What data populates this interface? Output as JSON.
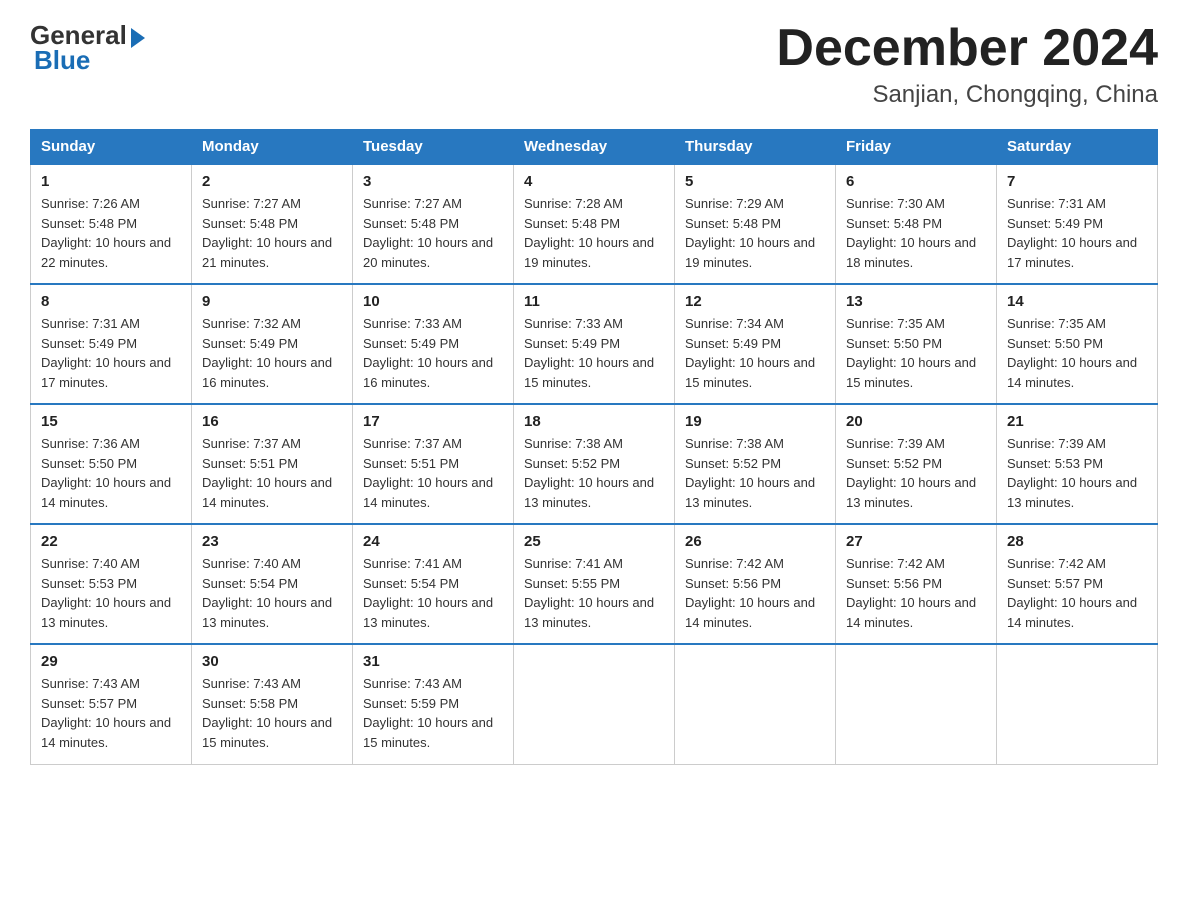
{
  "logo": {
    "general": "General",
    "blue": "Blue"
  },
  "header": {
    "month": "December 2024",
    "location": "Sanjian, Chongqing, China"
  },
  "days_of_week": [
    "Sunday",
    "Monday",
    "Tuesday",
    "Wednesday",
    "Thursday",
    "Friday",
    "Saturday"
  ],
  "weeks": [
    [
      {
        "day": "1",
        "sunrise": "7:26 AM",
        "sunset": "5:48 PM",
        "daylight": "10 hours and 22 minutes."
      },
      {
        "day": "2",
        "sunrise": "7:27 AM",
        "sunset": "5:48 PM",
        "daylight": "10 hours and 21 minutes."
      },
      {
        "day": "3",
        "sunrise": "7:27 AM",
        "sunset": "5:48 PM",
        "daylight": "10 hours and 20 minutes."
      },
      {
        "day": "4",
        "sunrise": "7:28 AM",
        "sunset": "5:48 PM",
        "daylight": "10 hours and 19 minutes."
      },
      {
        "day": "5",
        "sunrise": "7:29 AM",
        "sunset": "5:48 PM",
        "daylight": "10 hours and 19 minutes."
      },
      {
        "day": "6",
        "sunrise": "7:30 AM",
        "sunset": "5:48 PM",
        "daylight": "10 hours and 18 minutes."
      },
      {
        "day": "7",
        "sunrise": "7:31 AM",
        "sunset": "5:49 PM",
        "daylight": "10 hours and 17 minutes."
      }
    ],
    [
      {
        "day": "8",
        "sunrise": "7:31 AM",
        "sunset": "5:49 PM",
        "daylight": "10 hours and 17 minutes."
      },
      {
        "day": "9",
        "sunrise": "7:32 AM",
        "sunset": "5:49 PM",
        "daylight": "10 hours and 16 minutes."
      },
      {
        "day": "10",
        "sunrise": "7:33 AM",
        "sunset": "5:49 PM",
        "daylight": "10 hours and 16 minutes."
      },
      {
        "day": "11",
        "sunrise": "7:33 AM",
        "sunset": "5:49 PM",
        "daylight": "10 hours and 15 minutes."
      },
      {
        "day": "12",
        "sunrise": "7:34 AM",
        "sunset": "5:49 PM",
        "daylight": "10 hours and 15 minutes."
      },
      {
        "day": "13",
        "sunrise": "7:35 AM",
        "sunset": "5:50 PM",
        "daylight": "10 hours and 15 minutes."
      },
      {
        "day": "14",
        "sunrise": "7:35 AM",
        "sunset": "5:50 PM",
        "daylight": "10 hours and 14 minutes."
      }
    ],
    [
      {
        "day": "15",
        "sunrise": "7:36 AM",
        "sunset": "5:50 PM",
        "daylight": "10 hours and 14 minutes."
      },
      {
        "day": "16",
        "sunrise": "7:37 AM",
        "sunset": "5:51 PM",
        "daylight": "10 hours and 14 minutes."
      },
      {
        "day": "17",
        "sunrise": "7:37 AM",
        "sunset": "5:51 PM",
        "daylight": "10 hours and 14 minutes."
      },
      {
        "day": "18",
        "sunrise": "7:38 AM",
        "sunset": "5:52 PM",
        "daylight": "10 hours and 13 minutes."
      },
      {
        "day": "19",
        "sunrise": "7:38 AM",
        "sunset": "5:52 PM",
        "daylight": "10 hours and 13 minutes."
      },
      {
        "day": "20",
        "sunrise": "7:39 AM",
        "sunset": "5:52 PM",
        "daylight": "10 hours and 13 minutes."
      },
      {
        "day": "21",
        "sunrise": "7:39 AM",
        "sunset": "5:53 PM",
        "daylight": "10 hours and 13 minutes."
      }
    ],
    [
      {
        "day": "22",
        "sunrise": "7:40 AM",
        "sunset": "5:53 PM",
        "daylight": "10 hours and 13 minutes."
      },
      {
        "day": "23",
        "sunrise": "7:40 AM",
        "sunset": "5:54 PM",
        "daylight": "10 hours and 13 minutes."
      },
      {
        "day": "24",
        "sunrise": "7:41 AM",
        "sunset": "5:54 PM",
        "daylight": "10 hours and 13 minutes."
      },
      {
        "day": "25",
        "sunrise": "7:41 AM",
        "sunset": "5:55 PM",
        "daylight": "10 hours and 13 minutes."
      },
      {
        "day": "26",
        "sunrise": "7:42 AM",
        "sunset": "5:56 PM",
        "daylight": "10 hours and 14 minutes."
      },
      {
        "day": "27",
        "sunrise": "7:42 AM",
        "sunset": "5:56 PM",
        "daylight": "10 hours and 14 minutes."
      },
      {
        "day": "28",
        "sunrise": "7:42 AM",
        "sunset": "5:57 PM",
        "daylight": "10 hours and 14 minutes."
      }
    ],
    [
      {
        "day": "29",
        "sunrise": "7:43 AM",
        "sunset": "5:57 PM",
        "daylight": "10 hours and 14 minutes."
      },
      {
        "day": "30",
        "sunrise": "7:43 AM",
        "sunset": "5:58 PM",
        "daylight": "10 hours and 15 minutes."
      },
      {
        "day": "31",
        "sunrise": "7:43 AM",
        "sunset": "5:59 PM",
        "daylight": "10 hours and 15 minutes."
      },
      null,
      null,
      null,
      null
    ]
  ]
}
